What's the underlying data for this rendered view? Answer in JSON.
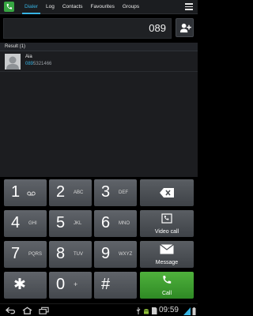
{
  "tabs": [
    {
      "label": "Dialer",
      "active": true
    },
    {
      "label": "Log",
      "active": false
    },
    {
      "label": "Contacts",
      "active": false
    },
    {
      "label": "Favourites",
      "active": false
    },
    {
      "label": "Groups",
      "active": false
    }
  ],
  "dial": {
    "number": "089"
  },
  "results": {
    "header": "Result (1)",
    "items": [
      {
        "name": "Aia",
        "number_match": "089",
        "number_rest": "5321466"
      }
    ]
  },
  "keypad": {
    "keys": [
      {
        "digit": "1",
        "letters": ""
      },
      {
        "digit": "2",
        "letters": "ABC"
      },
      {
        "digit": "3",
        "letters": "DEF"
      },
      {
        "digit": "4",
        "letters": "GHI"
      },
      {
        "digit": "5",
        "letters": "JKL"
      },
      {
        "digit": "6",
        "letters": "MNO"
      },
      {
        "digit": "7",
        "letters": "PQRS"
      },
      {
        "digit": "8",
        "letters": "TUV"
      },
      {
        "digit": "9",
        "letters": "WXYZ"
      },
      {
        "digit": "✱",
        "letters": ""
      },
      {
        "digit": "0",
        "letters": "+"
      },
      {
        "digit": "#",
        "letters": ""
      }
    ],
    "video_call_label": "Video call",
    "message_label": "Message",
    "call_label": "Call"
  },
  "status": {
    "time": "09:59"
  },
  "colors": {
    "accent": "#36b3e3",
    "call_green": "#3c9e2e"
  }
}
